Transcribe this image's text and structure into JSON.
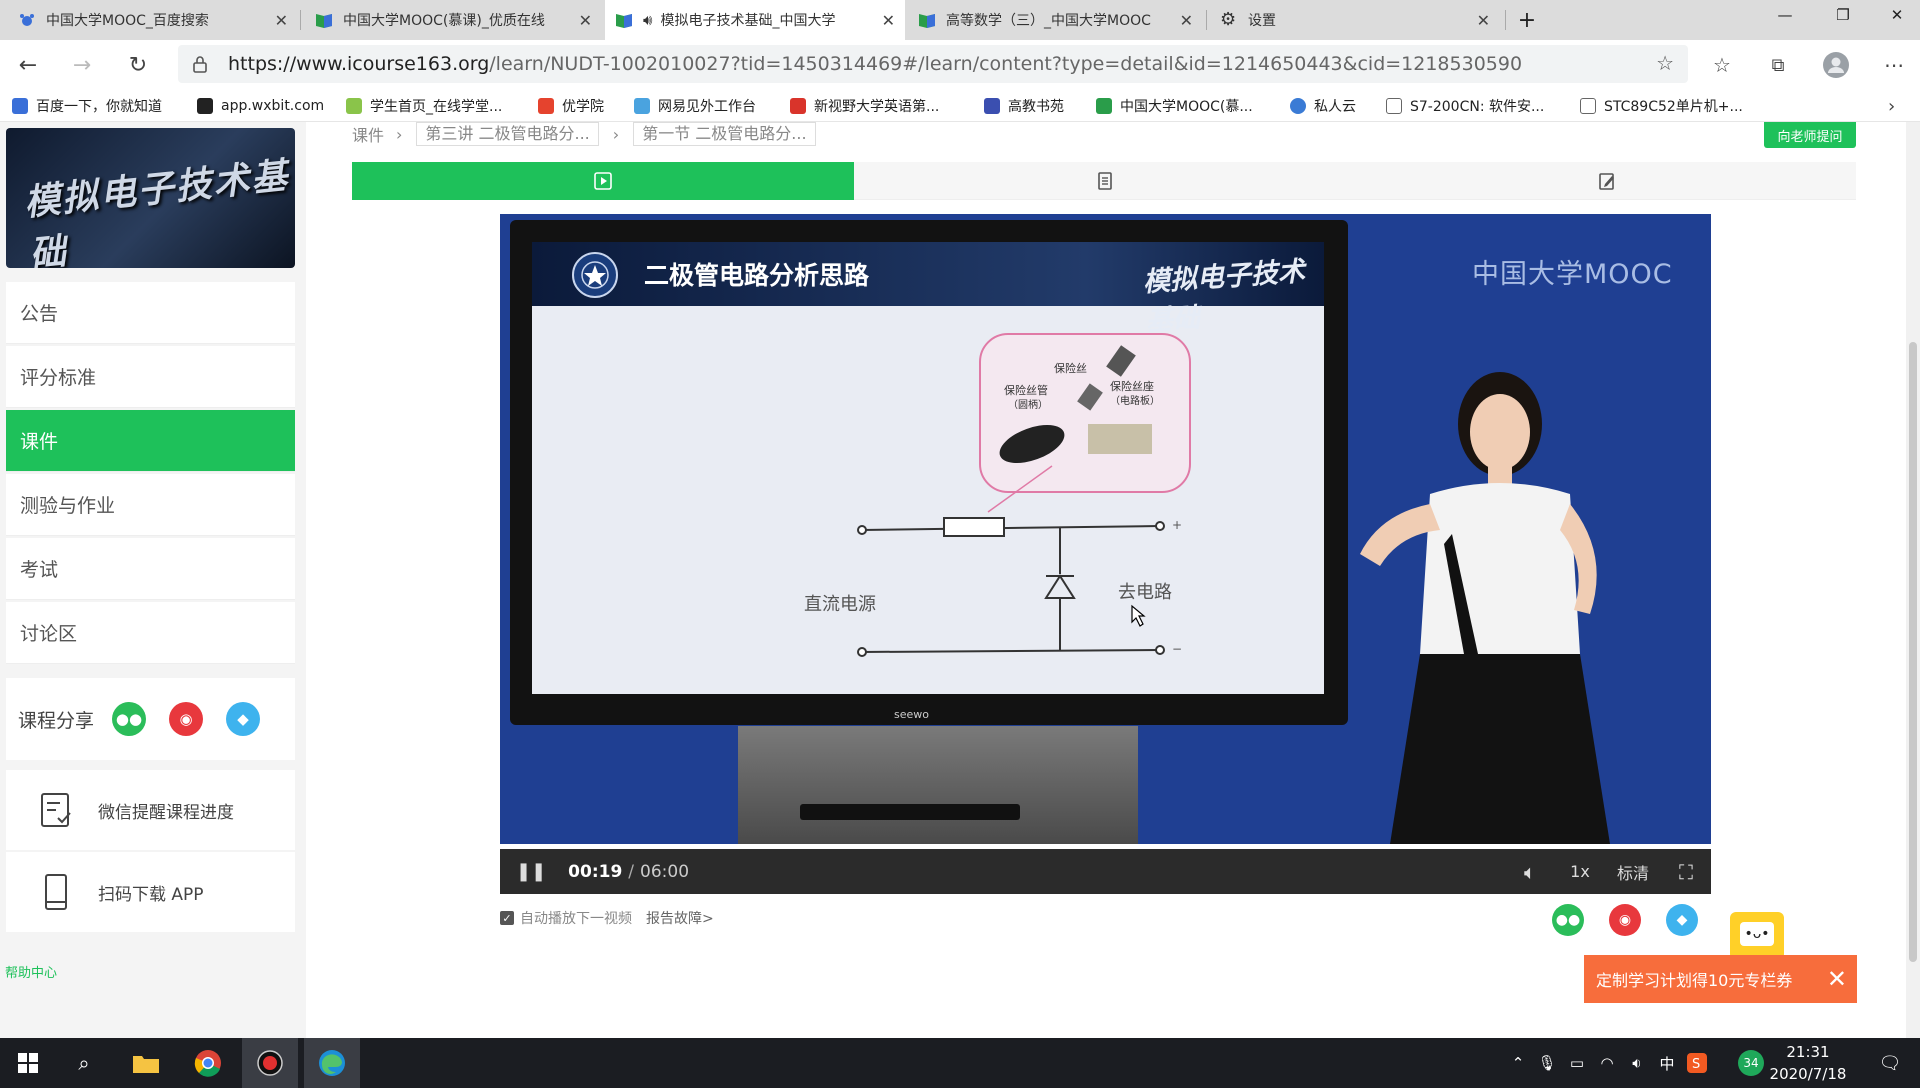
{
  "browser": {
    "tabs": [
      {
        "label": "中国大学MOOC_百度搜索",
        "active": false
      },
      {
        "label": "中国大学MOOC(慕课)_优质在线",
        "active": false
      },
      {
        "label": "模拟电子技术基础_中国大学",
        "active": true
      },
      {
        "label": "高等数学（三）_中国大学MOOC",
        "active": false
      },
      {
        "label": "设置",
        "active": false
      }
    ],
    "url_host": "https://www.icourse163.org",
    "url_rest": "/learn/NUDT-1002010027?tid=1450314469#/learn/content?type=detail&id=1214650443&cid=1218530590",
    "bookmarks": [
      {
        "label": "百度一下，你就知道",
        "color": "#3a6fd8"
      },
      {
        "label": "app.wxbit.com",
        "color": "#222222"
      },
      {
        "label": "学生首页_在线学堂...",
        "color": "#8ac44a"
      },
      {
        "label": "优学院",
        "color": "#e5432e"
      },
      {
        "label": "网易见外工作台",
        "color": "#4aa3df"
      },
      {
        "label": "新视野大学英语第...",
        "color": "#d9342b"
      },
      {
        "label": "高教书苑",
        "color": "#3b4fb0"
      },
      {
        "label": "中国大学MOOC(慕...",
        "color": "#2a9d4a"
      },
      {
        "label": "私人云",
        "color": "#3a7bd5"
      },
      {
        "label": "S7-200CN: 软件安...",
        "color": "#888888"
      },
      {
        "label": "STC89C52单片机+...",
        "color": "#888888"
      }
    ]
  },
  "course": {
    "banner_text": "模拟电子技术基础",
    "menu": [
      {
        "label": "公告",
        "active": false
      },
      {
        "label": "评分标准",
        "active": false
      },
      {
        "label": "课件",
        "active": true
      },
      {
        "label": "测验与作业",
        "active": false
      },
      {
        "label": "考试",
        "active": false
      },
      {
        "label": "讨论区",
        "active": false
      }
    ],
    "share_label": "课程分享",
    "wechat_reminder": "微信提醒课程进度",
    "download_app": "扫码下载 APP",
    "help_center": "帮助中心"
  },
  "main": {
    "breadcrumb": {
      "root": "课件",
      "lecture": "第三讲 二极管电路分...",
      "section": "第一节 二极管电路分..."
    },
    "ask_button": "向老师提问",
    "slide": {
      "title": "二极管电路分析思路",
      "brand": "模拟电子技术基础",
      "label_fuse": "保险丝",
      "label_fuse_holder_round": "保险丝管",
      "label_fuse_holder_round_sub": "（圆柄）",
      "label_fuse_holder_board": "保险丝座",
      "label_fuse_holder_board_sub": "（电路板）",
      "label_source": "直流电源",
      "label_circuit": "去电路",
      "plus": "+",
      "minus": "−",
      "tv_brand": "seewo"
    },
    "video_logo": "中国大学MOOC",
    "player": {
      "current_time": "00:19",
      "separator": "/",
      "duration": "06:00",
      "played_fraction": 0.053,
      "buffered_fraction": 0.155,
      "speed": "1x",
      "quality": "标清"
    },
    "autoplay_label": "自动播放下一视频",
    "report_label": "报告故障>",
    "promo_text": "定制学习计划得10元专栏券"
  },
  "taskbar": {
    "time": "21:31",
    "date": "2020/7/18",
    "ime": "中",
    "badge": "34"
  }
}
